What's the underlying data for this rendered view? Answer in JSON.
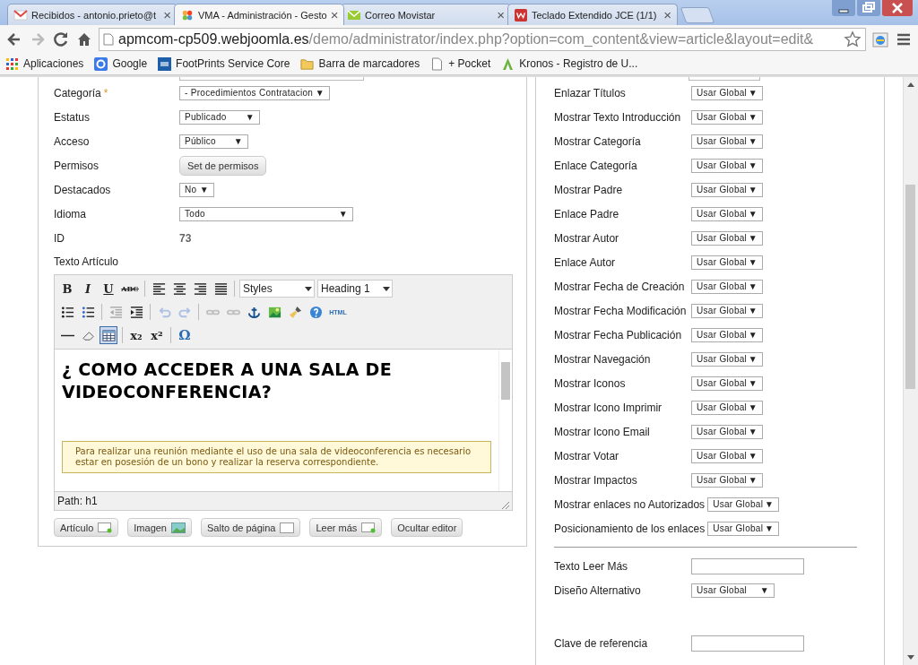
{
  "browser": {
    "tabs": [
      {
        "title": "Recibidos - antonio.prieto@t",
        "selected": false
      },
      {
        "title": "VMA - Administración - Gesto",
        "selected": true
      },
      {
        "title": "Correo Movistar",
        "selected": false
      },
      {
        "title": "Teclado Extendido JCE (1/1)",
        "selected": false
      }
    ],
    "close_label": "×",
    "address": {
      "host": "apmcom-cp509.webjoomla.es",
      "path": "/demo/administrator/index.php?option=com_content&view=article&layout=edit&"
    },
    "bookmarks": [
      {
        "label": "Aplicaciones"
      },
      {
        "label": "Google"
      },
      {
        "label": "FootPrints Service Core"
      },
      {
        "label": "Barra de marcadores"
      },
      {
        "label": "+ Pocket"
      },
      {
        "label": "Kronos - Registro de U..."
      }
    ]
  },
  "article": {
    "fields": [
      {
        "label": "Categoría",
        "required_mark": "*",
        "kind": "select",
        "value": "- Procedimientos Contratacion"
      },
      {
        "label": "Estatus",
        "kind": "select",
        "value": "Publicado"
      },
      {
        "label": "Acceso",
        "kind": "select",
        "value": "Público"
      },
      {
        "label": "Permisos",
        "kind": "button",
        "value": "Set de permisos"
      },
      {
        "label": "Destacados",
        "kind": "select",
        "value": "No"
      },
      {
        "label": "Idioma",
        "kind": "select",
        "value": "Todo"
      },
      {
        "label": "ID",
        "kind": "static",
        "value": "73"
      }
    ],
    "text_label": "Texto Artículo",
    "toolbar": [
      [
        {
          "kind": "bold",
          "label": "B",
          "disabled": false,
          "selected": false
        },
        {
          "kind": "italic",
          "label": "I",
          "disabled": false,
          "selected": false
        },
        {
          "kind": "underline",
          "label": "U",
          "disabled": false,
          "selected": false
        },
        {
          "kind": "strike",
          "label": "ABC",
          "disabled": false,
          "selected": false
        },
        {
          "kind": "sep"
        },
        {
          "kind": "align-left",
          "disabled": false,
          "selected": false
        },
        {
          "kind": "align-center",
          "disabled": false,
          "selected": false
        },
        {
          "kind": "align-right",
          "disabled": false,
          "selected": false
        },
        {
          "kind": "justify",
          "disabled": false,
          "selected": false
        },
        {
          "kind": "sep"
        },
        {
          "kind": "dropdown",
          "label": "Styles"
        },
        {
          "kind": "dropdown",
          "label": "Heading 1"
        }
      ],
      [
        {
          "kind": "bullets",
          "disabled": false,
          "selected": false
        },
        {
          "kind": "numbers",
          "disabled": false,
          "selected": false
        },
        {
          "kind": "sep"
        },
        {
          "kind": "outdent",
          "disabled": true,
          "selected": false
        },
        {
          "kind": "indent",
          "disabled": false,
          "selected": false
        },
        {
          "kind": "sep"
        },
        {
          "kind": "undo",
          "disabled": true,
          "selected": false
        },
        {
          "kind": "redo",
          "disabled": true,
          "selected": false
        },
        {
          "kind": "sep"
        },
        {
          "kind": "link",
          "disabled": true,
          "selected": false
        },
        {
          "kind": "unlink",
          "disabled": true,
          "selected": false
        },
        {
          "kind": "anchor",
          "disabled": false,
          "selected": false
        },
        {
          "kind": "image",
          "disabled": false,
          "selected": false
        },
        {
          "kind": "cleanup",
          "disabled": false,
          "selected": false
        },
        {
          "kind": "help",
          "disabled": false,
          "selected": false
        },
        {
          "kind": "html",
          "label": "HTML",
          "disabled": false,
          "selected": false
        }
      ],
      [
        {
          "kind": "hr",
          "disabled": false,
          "selected": false
        },
        {
          "kind": "eraser",
          "disabled": false,
          "selected": false
        },
        {
          "kind": "table",
          "disabled": false,
          "selected": true
        },
        {
          "kind": "sep"
        },
        {
          "kind": "bold",
          "label": "x₂",
          "disabled": false,
          "selected": false
        },
        {
          "kind": "bold",
          "label": "x²",
          "disabled": false,
          "selected": false
        },
        {
          "kind": "sep"
        },
        {
          "kind": "omega",
          "label": "Ω",
          "disabled": false,
          "selected": false
        }
      ]
    ],
    "heading": "¿ COMO ACCEDER A UNA SALA DE VIDEOCONFERENCIA?",
    "notice": "Para realizar una reunión mediante el uso de una sala de videoconferencia es necesario estar en posesión de un bono y realizar la reserva correspondiente.",
    "path": "Path: h1",
    "buttons": [
      {
        "label": "Artículo"
      },
      {
        "label": "Imagen"
      },
      {
        "label": "Salto de página"
      },
      {
        "label": "Leer más"
      },
      {
        "label": "Ocultar editor"
      }
    ]
  },
  "options": [
    {
      "label": "Enlazar Títulos",
      "kind": "select",
      "value": "Usar Global"
    },
    {
      "label": "Mostrar Texto Introducción",
      "kind": "select",
      "value": "Usar Global"
    },
    {
      "label": "Mostrar Categoría",
      "kind": "select",
      "value": "Usar Global"
    },
    {
      "label": "Enlace Categoría",
      "kind": "select",
      "value": "Usar Global"
    },
    {
      "label": "Mostrar Padre",
      "kind": "select",
      "value": "Usar Global"
    },
    {
      "label": "Enlace Padre",
      "kind": "select",
      "value": "Usar Global"
    },
    {
      "label": "Mostrar Autor",
      "kind": "select",
      "value": "Usar Global"
    },
    {
      "label": "Enlace Autor",
      "kind": "select",
      "value": "Usar Global"
    },
    {
      "label": "Mostrar Fecha de Creación",
      "kind": "select",
      "value": "Usar Global"
    },
    {
      "label": "Mostrar Fecha Modificación",
      "kind": "select",
      "value": "Usar Global"
    },
    {
      "label": "Mostrar Fecha Publicación",
      "kind": "select",
      "value": "Usar Global"
    },
    {
      "label": "Mostrar Navegación",
      "kind": "select",
      "value": "Usar Global"
    },
    {
      "label": "Mostrar Iconos",
      "kind": "select",
      "value": "Usar Global"
    },
    {
      "label": "Mostrar Icono Imprimir",
      "kind": "select",
      "value": "Usar Global"
    },
    {
      "label": "Mostrar Icono Email",
      "kind": "select",
      "value": "Usar Global"
    },
    {
      "label": "Mostrar Votar",
      "kind": "select",
      "value": "Usar Global"
    },
    {
      "label": "Mostrar Impactos",
      "kind": "select",
      "value": "Usar Global"
    },
    {
      "label": "Mostrar enlaces no Autorizados",
      "kind": "select",
      "value": "Usar Global"
    },
    {
      "label": "Posicionamiento de los enlaces",
      "kind": "select",
      "value": "Usar Global"
    },
    {
      "kind": "divider"
    },
    {
      "label": "Texto Leer Más",
      "kind": "text"
    },
    {
      "label": "Diseño Alternativo",
      "kind": "select",
      "value": "Usar Global"
    },
    {
      "kind": "spacer"
    },
    {
      "label": "Clave de referencia",
      "kind": "text"
    }
  ],
  "select_arrow": "▼"
}
